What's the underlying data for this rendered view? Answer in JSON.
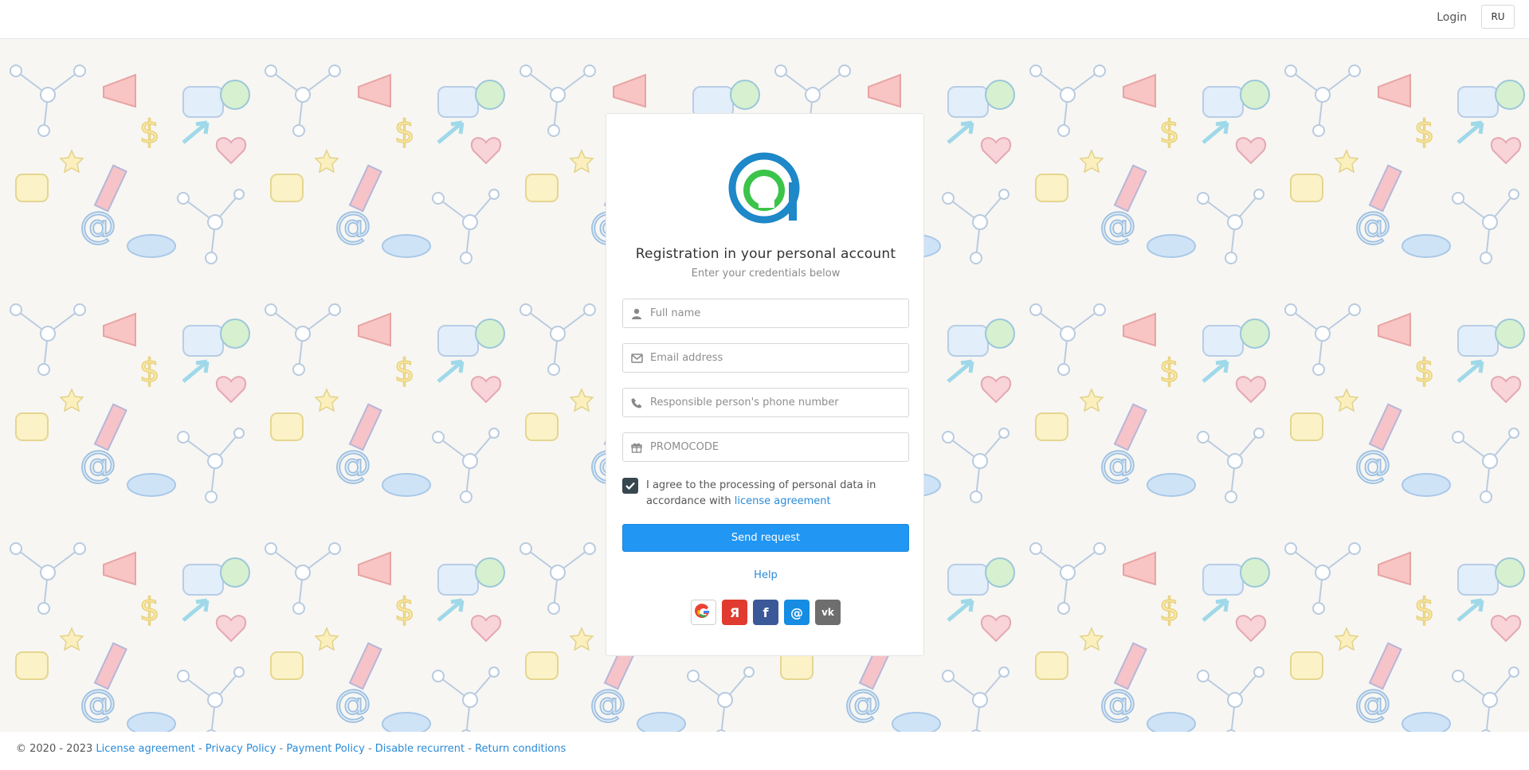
{
  "header": {
    "login_label": "Login",
    "lang_label": "RU"
  },
  "card": {
    "title": "Registration in your personal account",
    "subtitle": "Enter your credentials below",
    "fields": {
      "full_name_placeholder": "Full name",
      "email_placeholder": "Email address",
      "phone_placeholder": "Responsible person's phone number",
      "promocode_placeholder": "PROMOCODE"
    },
    "agree": {
      "text": "I agree to the processing of personal data in accordance with",
      "link": "license agreement",
      "checked": true
    },
    "send_label": "Send request",
    "help_label": "Help",
    "socials": [
      {
        "icon": "google-icon",
        "glyph": "G"
      },
      {
        "icon": "yandex-icon",
        "glyph": "Я"
      },
      {
        "icon": "facebook-icon",
        "glyph": "f"
      },
      {
        "icon": "mailru-icon",
        "glyph": "@"
      },
      {
        "icon": "vk-icon",
        "glyph": "vk"
      }
    ]
  },
  "footer": {
    "copyright": "© 2020 - 2023",
    "links": [
      "License agreement",
      "Privacy Policy",
      "Payment Policy",
      "Disable recurrent",
      "Return conditions"
    ],
    "separator": " - "
  },
  "colors": {
    "accent": "#2196f3",
    "link": "#2a8bd8",
    "checkbox": "#37474f",
    "background": "#f7f6f2"
  }
}
